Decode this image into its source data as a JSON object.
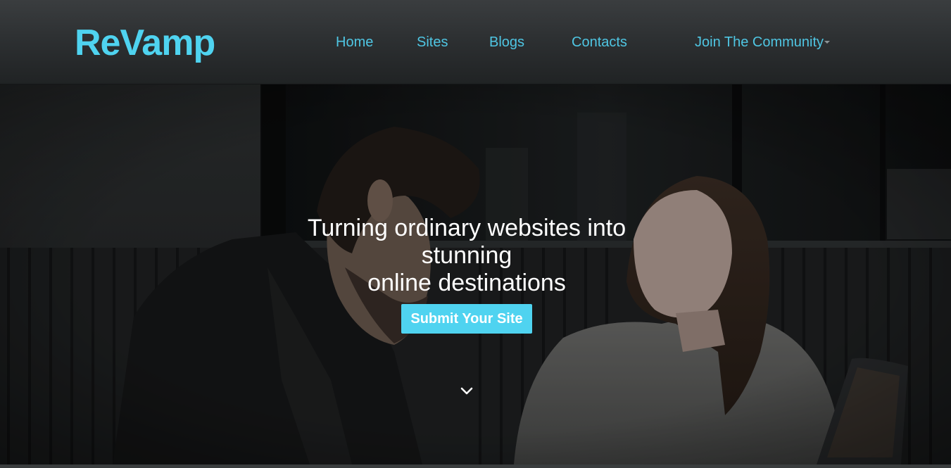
{
  "brand": {
    "logo_text": "ReVamp",
    "accent_color": "#4fd3f0"
  },
  "nav": {
    "items": [
      {
        "label": "Home"
      },
      {
        "label": "Sites"
      },
      {
        "label": "Blogs"
      },
      {
        "label": "Contacts"
      },
      {
        "label": "Join The Community",
        "icon": "caret-down-icon"
      }
    ]
  },
  "hero": {
    "title_line1": "Turning ordinary websites into",
    "title_line2": "stunning",
    "title_line3": "online destinations",
    "cta_label": "Submit Your Site",
    "scroll_icon": "chevron-down-icon"
  }
}
